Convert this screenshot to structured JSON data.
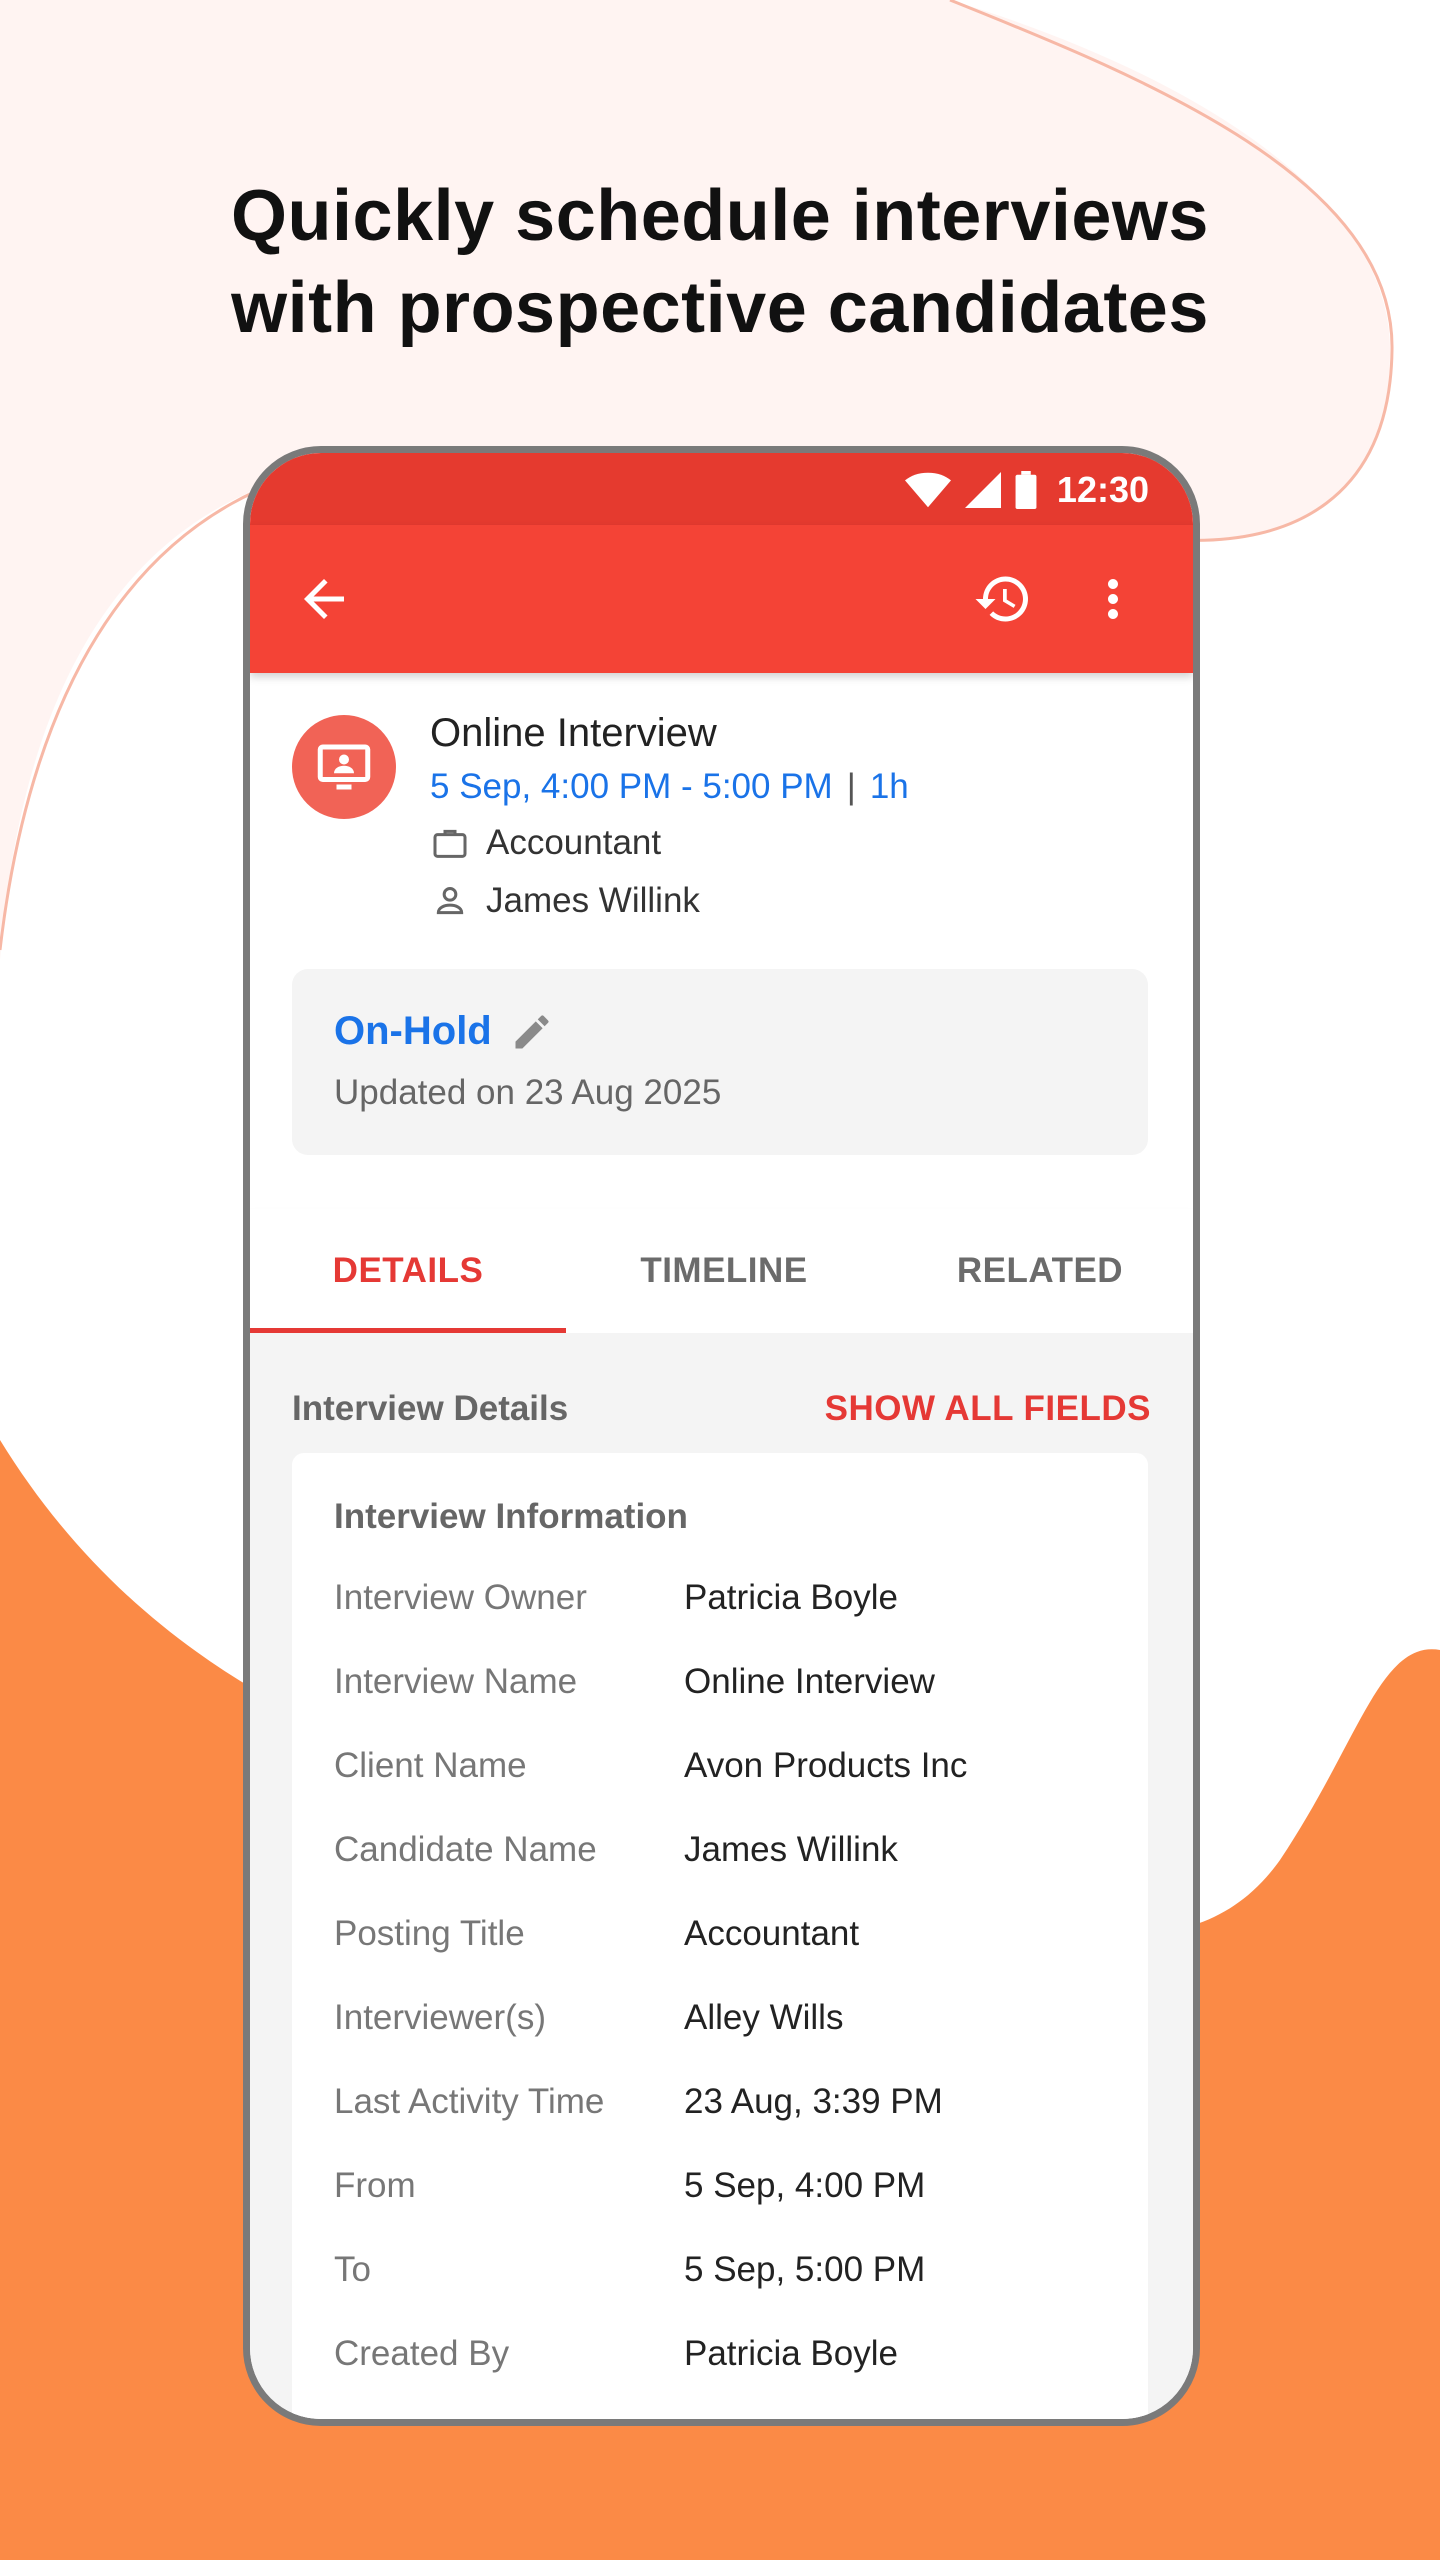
{
  "headline": {
    "line1": "Quickly schedule interviews",
    "line2": "with prospective candidates"
  },
  "colors": {
    "accent": "#f44336",
    "status_bar": "#e53a2f",
    "link_blue": "#1a73e8",
    "background_blob_orange": "#fb8a46",
    "background_blob_pink": "#fff4f2"
  },
  "status_bar": {
    "time": "12:30",
    "icons": [
      "wifi-icon",
      "signal-icon",
      "battery-icon"
    ]
  },
  "app_bar": {
    "icons": [
      "back-arrow-icon",
      "history-icon",
      "more-vert-icon"
    ]
  },
  "interview": {
    "title": "Online Interview",
    "datetime": "5 Sep, 4:00 PM - 5:00 PM",
    "separator": "|",
    "duration": "1h",
    "job": "Accountant",
    "candidate": "James Willink",
    "avatar_icon": "presentation-screen-icon"
  },
  "status_card": {
    "status": "On-Hold",
    "updated": "Updated on 23 Aug 2025",
    "edit_icon": "pencil-icon"
  },
  "tabs": [
    {
      "label": "DETAILS",
      "active": true
    },
    {
      "label": "TIMELINE",
      "active": false
    },
    {
      "label": "RELATED",
      "active": false
    }
  ],
  "details": {
    "section_title": "Interview Details",
    "show_all": "SHOW ALL FIELDS",
    "card_title": "Interview Information",
    "fields": [
      {
        "label": "Interview Owner",
        "value": "Patricia Boyle"
      },
      {
        "label": "Interview Name",
        "value": "Online Interview"
      },
      {
        "label": "Client Name",
        "value": "Avon Products Inc"
      },
      {
        "label": "Candidate Name",
        "value": "James Willink"
      },
      {
        "label": "Posting Title",
        "value": "Accountant"
      },
      {
        "label": "Interviewer(s)",
        "value": "Alley Wills"
      },
      {
        "label": "Last Activity Time",
        "value": "23 Aug, 3:39 PM"
      },
      {
        "label": "From",
        "value": "5 Sep, 4:00 PM"
      },
      {
        "label": "To",
        "value": "5 Sep, 5:00 PM"
      },
      {
        "label": "Created By",
        "value": "Patricia Boyle"
      }
    ]
  }
}
